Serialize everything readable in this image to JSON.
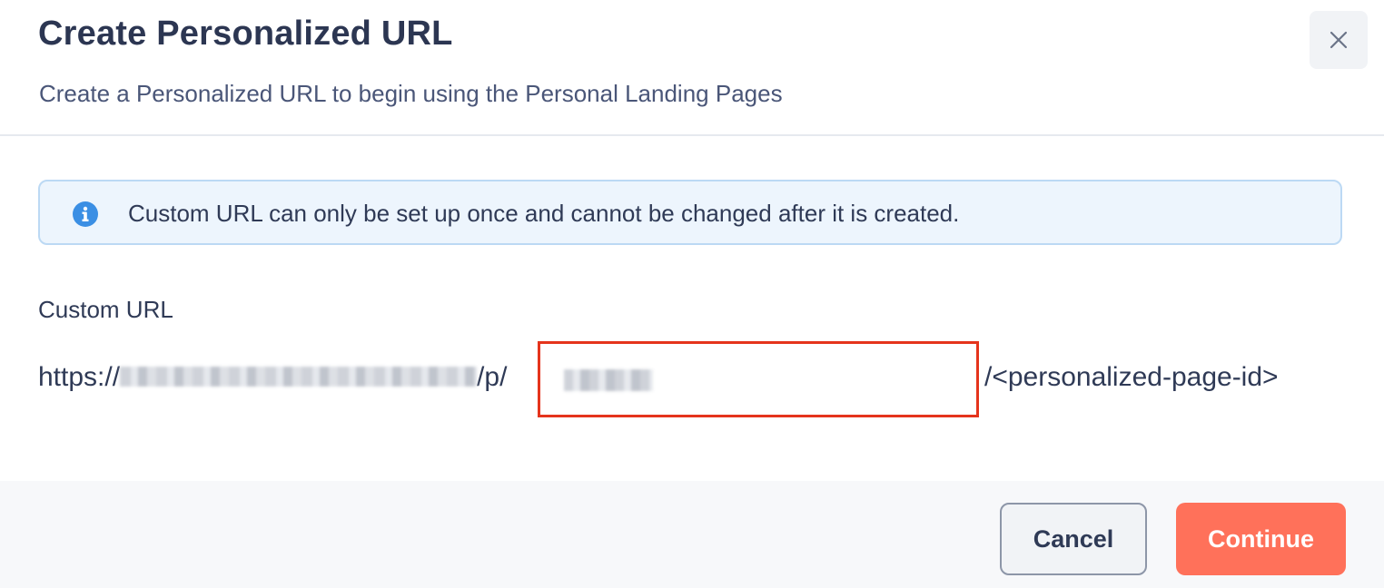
{
  "dialog": {
    "title": "Create Personalized URL",
    "subtitle": "Create a Personalized URL to begin using the Personal Landing Pages",
    "close_icon": "close-icon"
  },
  "alert": {
    "icon": "info-icon",
    "text": "Custom URL can only be set up once and cannot be changed after it is created.",
    "accent_color": "#3b8fe4"
  },
  "form": {
    "label": "Custom URL",
    "url_scheme": "https://",
    "url_path_prefix": "/p/",
    "url_suffix": "/<personalized-page-id>",
    "highlight_color": "#e5341c"
  },
  "footer": {
    "cancel_label": "Cancel",
    "continue_label": "Continue",
    "continue_color": "#ff715a"
  }
}
